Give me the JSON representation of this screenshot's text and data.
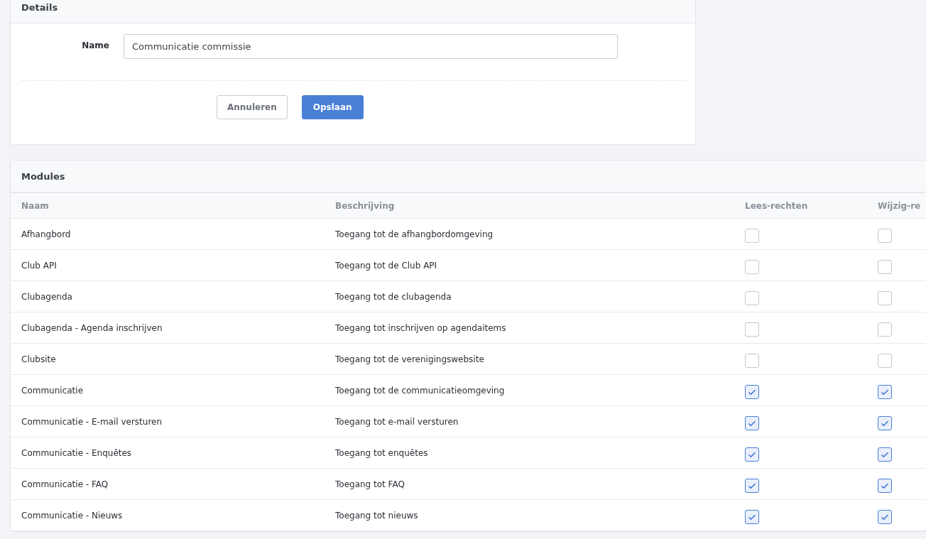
{
  "details": {
    "title": "Details",
    "name_label": "Name",
    "name_value": "Communicatie commissie",
    "buttons": [
      {
        "label": "Annuleren",
        "kind": "secondary"
      },
      {
        "label": "Opslaan",
        "kind": "primary"
      }
    ]
  },
  "modules": {
    "title": "Modules",
    "columns": [
      "Naam",
      "Beschrijving",
      "Lees-rechten",
      "Wijzig-re"
    ],
    "rows": [
      {
        "name": "Afhangbord",
        "description": "Toegang tot de afhangbordomgeving",
        "read": false,
        "write": false
      },
      {
        "name": "Club API",
        "description": "Toegang tot de Club API",
        "read": false,
        "write": false
      },
      {
        "name": "Clubagenda",
        "description": "Toegang tot de clubagenda",
        "read": false,
        "write": false
      },
      {
        "name": "Clubagenda - Agenda inschrijven",
        "description": "Toegang tot inschrijven op agendaitems",
        "read": false,
        "write": false
      },
      {
        "name": "Clubsite",
        "description": "Toegang tot de verenigingswebsite",
        "read": false,
        "write": false
      },
      {
        "name": "Communicatie",
        "description": "Toegang tot de communicatieomgeving",
        "read": true,
        "write": true
      },
      {
        "name": "Communicatie - E-mail versturen",
        "description": "Toegang tot e-mail versturen",
        "read": true,
        "write": true
      },
      {
        "name": "Communicatie - Enquêtes",
        "description": "Toegang tot enquêtes",
        "read": true,
        "write": true
      },
      {
        "name": "Communicatie - FAQ",
        "description": "Toegang tot FAQ",
        "read": true,
        "write": true
      },
      {
        "name": "Communicatie - Nieuws",
        "description": "Toegang tot nieuws",
        "read": true,
        "write": true
      }
    ]
  }
}
